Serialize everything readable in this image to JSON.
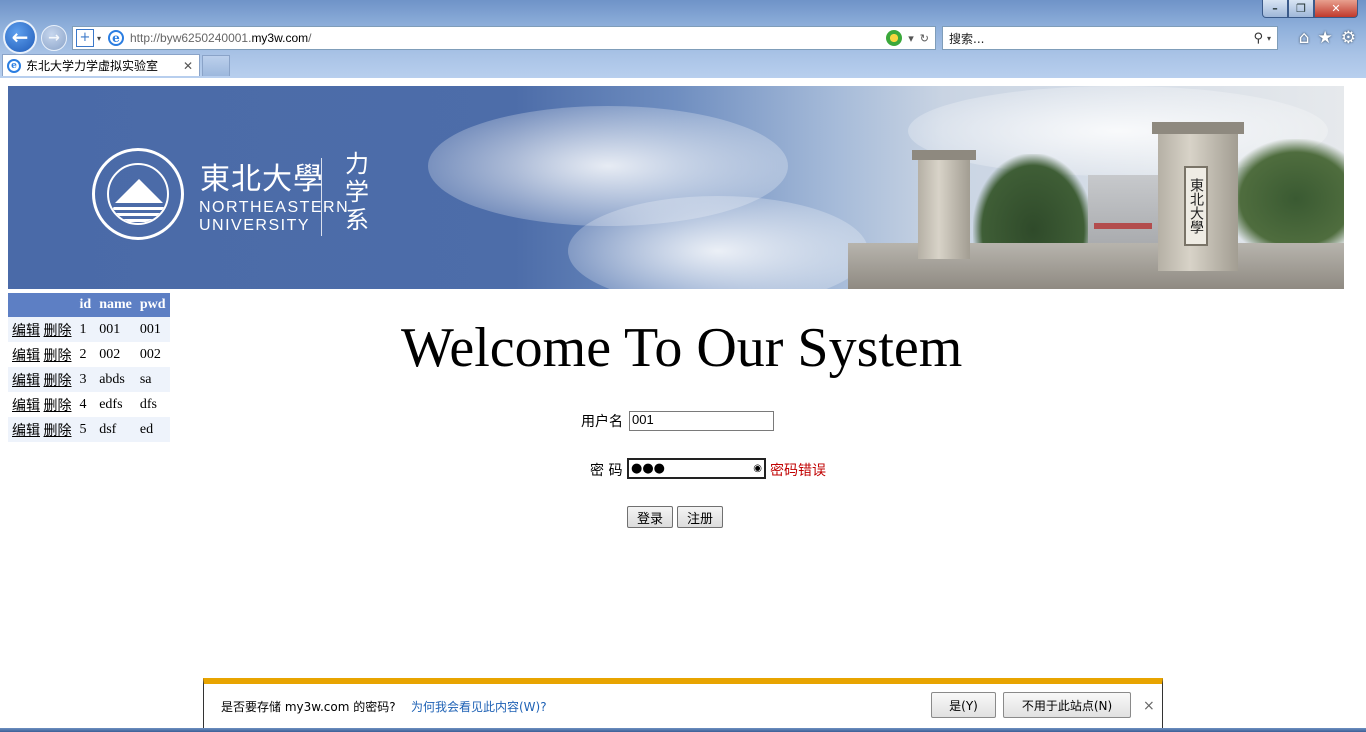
{
  "browser": {
    "url_prefix": "http://byw6250240001.",
    "url_host": "my3w.com",
    "url_suffix": "/",
    "search_placeholder": "搜索...",
    "tab_title": "东北大学力学虚拟实验室",
    "win_min": "–",
    "win_max": "❐",
    "win_close": "✕",
    "back_glyph": "←",
    "forward_glyph": "→",
    "icons": [
      "back-icon",
      "forward-icon",
      "compat-icon",
      "ie-icon",
      "refresh-icon",
      "search-icon",
      "home-icon",
      "star-icon",
      "gear-icon"
    ]
  },
  "banner": {
    "logo_cn": "東北大學",
    "logo_en_line1": "NORTHEASTERN",
    "logo_en_line2": "UNIVERSITY",
    "dept": "力学系",
    "gate_plaque": "東北大學"
  },
  "table": {
    "headers": [
      "",
      "id",
      "name",
      "pwd"
    ],
    "edit_label": "编辑",
    "delete_label": "删除",
    "rows": [
      {
        "id": "1",
        "name": "001",
        "pwd": "001"
      },
      {
        "id": "2",
        "name": "002",
        "pwd": "002"
      },
      {
        "id": "3",
        "name": "abds",
        "pwd": "sa"
      },
      {
        "id": "4",
        "name": "edfs",
        "pwd": "dfs"
      },
      {
        "id": "5",
        "name": "dsf",
        "pwd": "ed"
      }
    ]
  },
  "login": {
    "welcome": "Welcome To Our System",
    "username_label": "用户名",
    "username_value": "001",
    "password_label": "密 码",
    "password_mask": "●●●",
    "password_error": "密码错误",
    "login_button": "登录",
    "register_button": "注册"
  },
  "notification": {
    "message": "是否要存储 my3w.com 的密码?",
    "link": "为何我会看见此内容(W)?",
    "yes_button": "是(Y)",
    "never_button": "不用于此站点(N)",
    "close": "×"
  },
  "colors": {
    "table_header": "#5d7fc4",
    "error_text": "#c00000",
    "notify_accent": "#e8a400",
    "link": "#1f62b5"
  }
}
